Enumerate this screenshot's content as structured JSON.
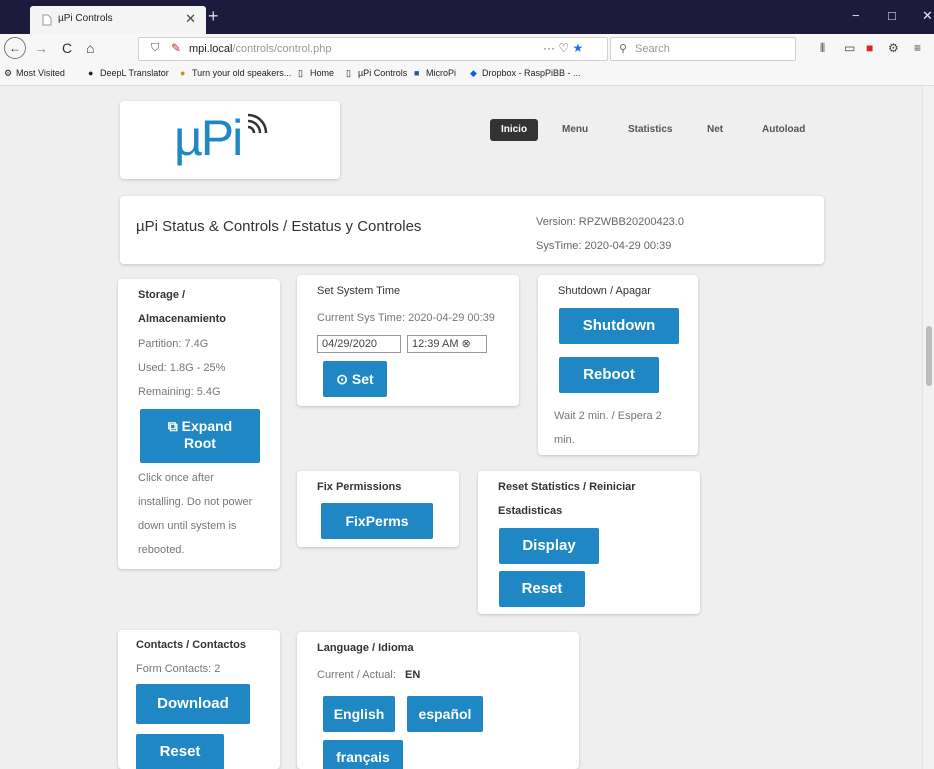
{
  "browser": {
    "tab_title": "µPi Controls",
    "tab_close": "✕",
    "new_tab": "+",
    "window_controls": {
      "minimize": "−",
      "maximize": "□",
      "close": "✕"
    },
    "nav": {
      "back": "←",
      "forward": "→",
      "reload": "C",
      "home": "⌂"
    },
    "url_host": "mpi.local",
    "url_path": "/controls/control.php",
    "url_actions": "···",
    "search_placeholder": "Search",
    "bookmarks": [
      {
        "icon": "gear-icon",
        "label": "Most Visited"
      },
      {
        "icon": "deepl-icon",
        "label": "DeepL Translator"
      },
      {
        "icon": "speaker-icon",
        "label": "Turn your old speakers..."
      },
      {
        "icon": "page-icon",
        "label": "Home"
      },
      {
        "icon": "page-icon",
        "label": "µPi Controls"
      },
      {
        "icon": "microsoft-icon",
        "label": "MicroPi"
      },
      {
        "icon": "dropbox-icon",
        "label": "Dropbox - RaspPiBB - ..."
      }
    ]
  },
  "logo": {
    "text": "µPi"
  },
  "mainnav": {
    "inicio": "Inicio",
    "menu": "Menu",
    "statistics": "Statistics",
    "net": "Net",
    "autoload": "Autoload"
  },
  "status": {
    "title": "µPi Status & Controls / Estatus y Controles",
    "version": "Version: RPZWBB20200423.0",
    "systime": "SysTime: 2020-04-29 00:39"
  },
  "storage": {
    "title_line1": "Storage /",
    "title_line2": "Almacenamiento",
    "partition": "Partition: 7.4G",
    "used": "Used: 1.8G - 25%",
    "remaining": "Remaining: 5.4G",
    "expand_line1": "Expand",
    "expand_line2": "Root",
    "note_lines": [
      "Click once after",
      "installing. Do not power",
      "down until system is",
      "rebooted."
    ]
  },
  "settime": {
    "title": "Set System Time",
    "current": "Current Sys Time: 2020-04-29 00:39",
    "date_value": "04/29/2020",
    "time_value": "12:39  AM",
    "set_label": "Set"
  },
  "shutdown": {
    "title": "Shutdown / Apagar",
    "shutdown_label": "Shutdown",
    "reboot_label": "Reboot",
    "wait_line1": "Wait 2 min. / Espera 2",
    "wait_line2": "min."
  },
  "fixperms": {
    "title": "Fix Permissions",
    "button_label": "FixPerms"
  },
  "resetstats": {
    "title_line1": "Reset Statistics / Reiniciar",
    "title_line2": "Estadisticas",
    "display_label": "Display",
    "reset_label": "Reset"
  },
  "contacts": {
    "title": "Contacts / Contactos",
    "form_contacts": "Form Contacts: 2",
    "download_label": "Download",
    "reset_label": "Reset"
  },
  "language": {
    "title": "Language / Idioma",
    "current_label": "Current / Actual:",
    "current_value": "EN",
    "english": "English",
    "espanol": "español",
    "francais": "français"
  }
}
